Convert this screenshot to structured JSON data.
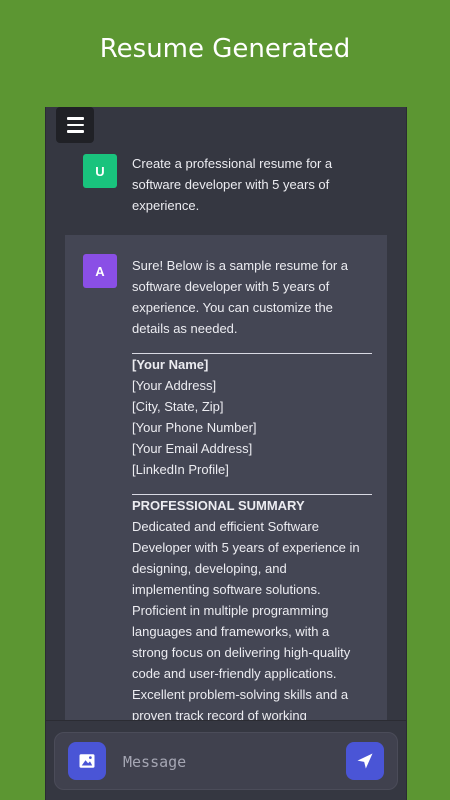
{
  "header": {
    "title": "Resume Generated"
  },
  "chat": {
    "menu_icon": "hamburger-menu-icon",
    "user": {
      "avatar_letter": "U",
      "avatar_color": "#19c37d",
      "lines": [
        "Create a professional resume for a",
        "software developer with 5 years of",
        "experience."
      ]
    },
    "assistant": {
      "avatar_letter": "A",
      "avatar_color": "#8a4fe6",
      "intro_lines": [
        "Sure! Below is a sample resume for a",
        "software developer with 5 years of",
        "experience. You can customize the",
        "details as needed."
      ],
      "contact": {
        "name": "[Your Name]",
        "address": "[Your Address]",
        "city": "[City, State, Zip]",
        "phone": "[Your Phone Number]",
        "email": "[Your Email Address]",
        "linkedin": "[LinkedIn Profile]"
      },
      "summary_heading": "PROFESSIONAL SUMMARY",
      "summary_lines": [
        "Dedicated and efficient Software",
        "Developer with 5 years of experience in",
        "designing, developing, and",
        "implementing software solutions.",
        "Proficient in multiple programming",
        "languages and frameworks, with a",
        "strong focus on delivering high-quality",
        "code and user-friendly applications.",
        "Excellent problem-solving skills and a",
        "proven track record of working"
      ]
    }
  },
  "composer": {
    "placeholder": "Message",
    "image_icon": "image-icon",
    "send_icon": "send-icon",
    "accent_color": "#4a55d6"
  }
}
